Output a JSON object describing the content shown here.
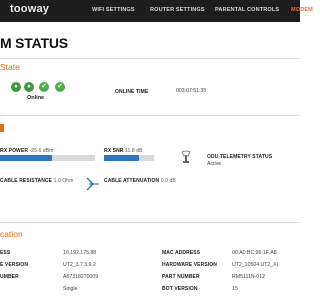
{
  "header": {
    "logo": "tooway",
    "nav": [
      {
        "label": "WIFI SETTINGS",
        "active": false
      },
      {
        "label": "ROUTER SETTINGS",
        "active": false
      },
      {
        "label": "PARENTAL CONTROLS",
        "active": false
      },
      {
        "label": "MODEM",
        "active": true
      }
    ]
  },
  "page_title": "M STATUS",
  "state_section": {
    "title": "State",
    "status_text": "Online",
    "online_time_label": "ONLINE TIME",
    "online_time_value": "003:07:51:35"
  },
  "signal_section": {
    "title": "",
    "rx_power_label": "RX POWER",
    "rx_power_value": "-25.6 dBm",
    "rx_power_fill": 0.55,
    "rx_snr_label": "RX SNR",
    "rx_snr_value": "11.8 dB",
    "rx_snr_fill": 0.7,
    "cable_resistance_label": "CABLE RESISTANCE",
    "cable_resistance_value": "1.0 Ohm",
    "cable_attenuation_label": "CABLE ATTENUATION",
    "cable_attenuation_value": "0.0 dB",
    "odu_label": "ODU TELEMETRY STATUS",
    "odu_value": "Active"
  },
  "info_section": {
    "title": "cation",
    "left": [
      {
        "label": "ESS",
        "value": "10.192.175.88"
      },
      {
        "label": "E VERSION",
        "value": "UT2_3.7.3.9.2"
      },
      {
        "label": "UMBER",
        "value": "A67318270009"
      },
      {
        "label": "",
        "value": "Single"
      }
    ],
    "right": [
      {
        "label": "MAC ADDRESS",
        "value": "00:A0:BC:96:1F:A8"
      },
      {
        "label": "HARDWARE VERSION",
        "value": "UT2_10504 UT2_X("
      },
      {
        "label": "PART NUMBER",
        "value": "RM5111N-012"
      },
      {
        "label": "BOT VERSION",
        "value": "15"
      }
    ]
  },
  "colors": {
    "accent": "#e46c1c",
    "bar_fill": "#2a79bf",
    "ok_green": "#4cae4c"
  }
}
